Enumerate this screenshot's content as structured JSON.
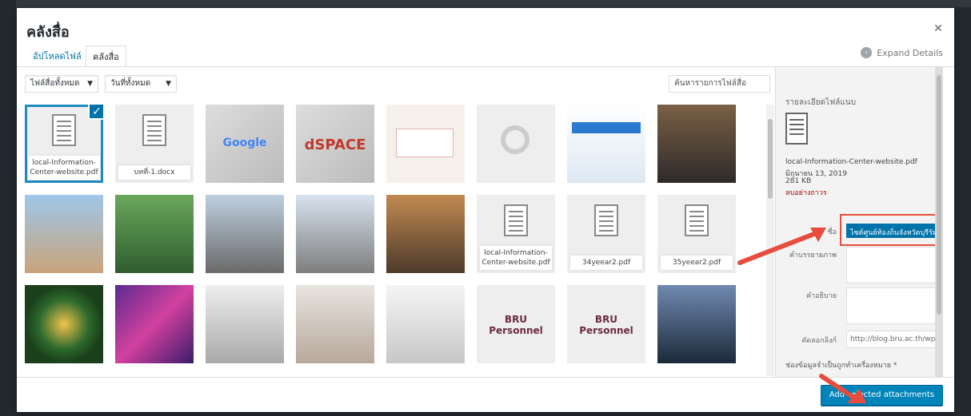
{
  "modal": {
    "title": "คลังสื่อ"
  },
  "tabs": [
    {
      "label": "อัปโหลดไฟล์"
    },
    {
      "label": "คลังสื่อ"
    }
  ],
  "expand_details": "Expand Details",
  "filters": {
    "type_value": "ไฟล์สื่อทั้งหมด",
    "date_value": "วันที่ทั้งหมด",
    "search_placeholder": "ค้นหารายการไฟล์สื่อ"
  },
  "grid": {
    "row1": [
      {
        "type": "doc",
        "filename": "local-Information-Center-website.pdf",
        "selected": true
      },
      {
        "type": "doc",
        "filename": "บทที่-1.docx"
      },
      {
        "type": "image",
        "brand": "Google"
      },
      {
        "type": "image",
        "brand": "dSPACE"
      },
      {
        "type": "image",
        "brand": ""
      },
      {
        "type": "image",
        "brand": ""
      },
      {
        "type": "image",
        "brand": ""
      },
      {
        "type": "image",
        "brand": ""
      }
    ],
    "row2": [
      {
        "type": "image"
      },
      {
        "type": "image"
      },
      {
        "type": "image"
      },
      {
        "type": "image"
      },
      {
        "type": "image"
      },
      {
        "type": "doc",
        "filename": "local-Information-Center-website.pdf"
      },
      {
        "type": "doc",
        "filename": "34yeear2.pdf"
      },
      {
        "type": "doc",
        "filename": "35yeear2.pdf"
      }
    ],
    "row3": [
      {
        "type": "image"
      },
      {
        "type": "image"
      },
      {
        "type": "image"
      },
      {
        "type": "image"
      },
      {
        "type": "image"
      },
      {
        "type": "image",
        "brand": "BRU Personnel"
      },
      {
        "type": "image",
        "brand": "BRU Personnel"
      },
      {
        "type": "image"
      }
    ]
  },
  "details": {
    "heading": "รายละเอียดไฟล์แนบ",
    "filename": "local-Information-Center-website.pdf",
    "date": "มิถุนายน 13, 2019",
    "size": "281 KB",
    "delete_link": "ลบอย่างถาวร",
    "title_label": "ชื่อ",
    "title_value": "ไซต์ศูนย์ท้องถิ่นจังหวัดบุรีรัมย์",
    "caption_label": "คำบรรยายภาพ",
    "description_label": "คำอธิบาย",
    "url_label": "คัดลอกลิงก์",
    "url_value": "http://blog.bru.ac.th/wp-co",
    "required_note": "ช่องข้อมูลจำเป็นถูกทำเครื่องหมาย *"
  },
  "footer": {
    "add_button": "Add selected attachments"
  },
  "colors": {
    "primary": "#0085ba",
    "highlight": "#e74c3c",
    "link": "#0073aa"
  }
}
